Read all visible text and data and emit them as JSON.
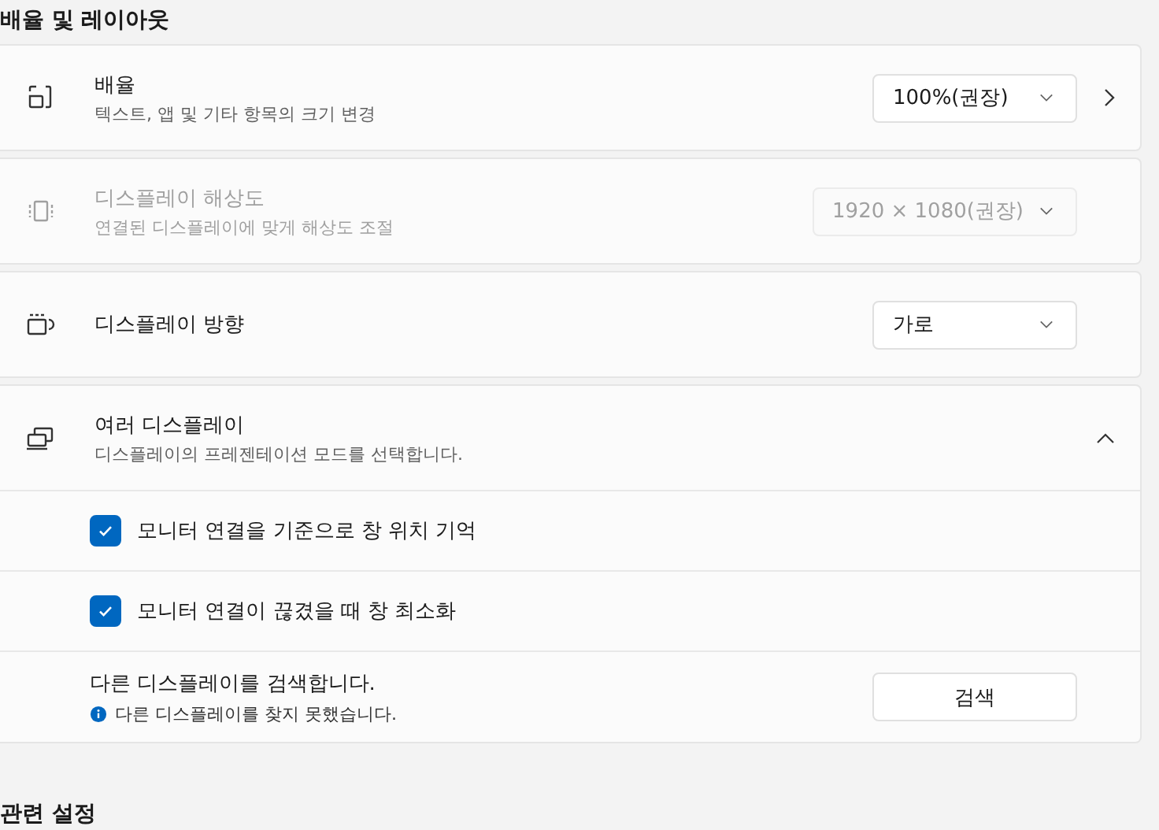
{
  "section_title": "배율 및 레이아웃",
  "settings": [
    {
      "kind": "dropdown_link",
      "title": "배율",
      "description": "텍스트, 앱 및 기타 항목의 크기 변경",
      "value": "100%(권장)",
      "disabled": false
    },
    {
      "kind": "dropdown",
      "title": "디스플레이 해상도",
      "description": "연결된 디스플레이에 맞게 해상도 조절",
      "value": "1920 × 1080(권장)",
      "disabled": true
    },
    {
      "kind": "dropdown",
      "title": "디스플레이 방향",
      "value": "가로",
      "disabled": false
    }
  ],
  "multiple_displays": {
    "title": "여러 디스플레이",
    "description": "디스플레이의 프레젠테이션 모드를 선택합니다.",
    "expanded": true,
    "options": [
      {
        "kind": "checkbox",
        "label": "모니터 연결을 기준으로 창 위치 기억",
        "checked": true
      },
      {
        "kind": "checkbox",
        "label": "모니터 연결이 끊겼을 때 창 최소화",
        "checked": true
      },
      {
        "kind": "action",
        "label": "다른 디스플레이를 검색합니다.",
        "info": "다른 디스플레이를 찾지 못했습니다.",
        "button": "검색"
      }
    ]
  },
  "related_title": "관련 설정"
}
